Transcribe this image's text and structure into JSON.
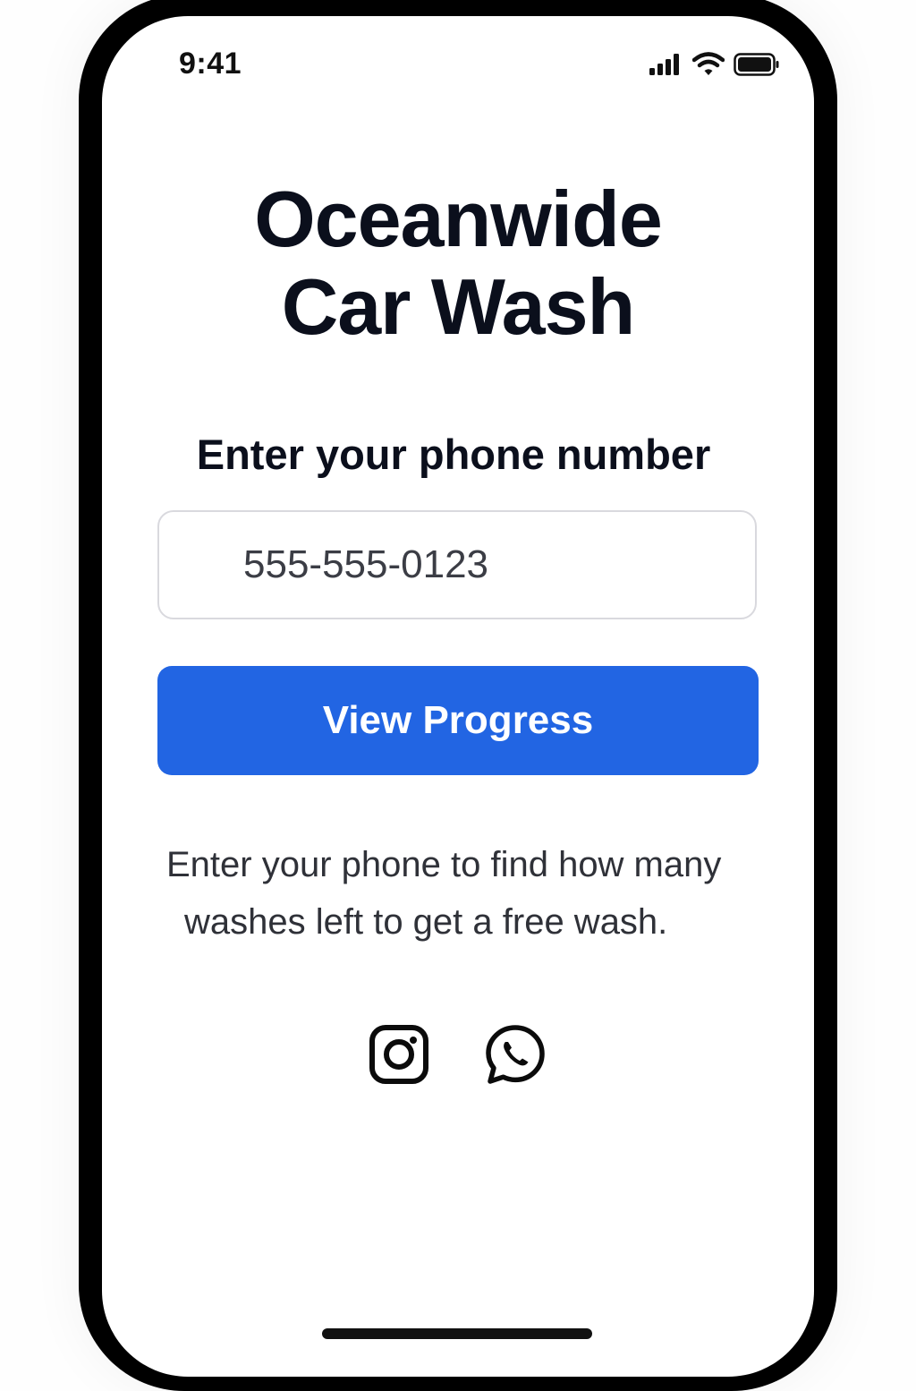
{
  "status_bar": {
    "time": "9:41",
    "icons": [
      "signal-icon",
      "wifi-icon",
      "battery-icon"
    ]
  },
  "app": {
    "title_line1": "Oceanwide",
    "title_line2": "Car Wash"
  },
  "form": {
    "phone_label": "Enter your phone number",
    "phone_value": "555-555-0123",
    "submit_label": "View Progress"
  },
  "helper": {
    "line1": "Enter your phone to find how many",
    "line2": "washes left to get a free wash."
  },
  "social": {
    "links": [
      "instagram-icon",
      "whatsapp-icon"
    ]
  },
  "colors": {
    "accent": "#2265e3",
    "title_text": "#0b0f1c",
    "body_text": "#2f3138",
    "frame": "#000000"
  }
}
